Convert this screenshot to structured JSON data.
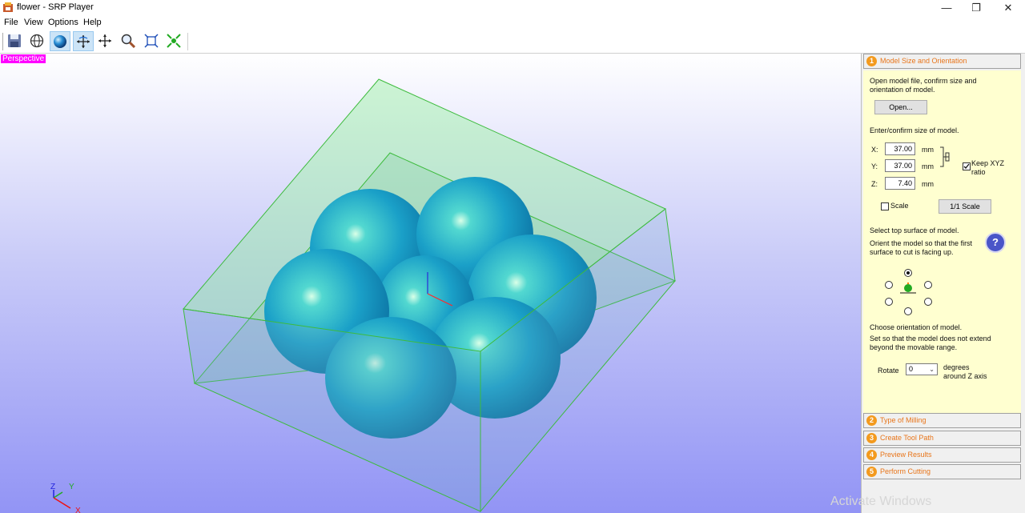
{
  "window": {
    "title": "flower - SRP Player",
    "minimize_label": "—",
    "maximize_label": "❐",
    "close_label": "✕"
  },
  "menu": {
    "items": [
      "File",
      "View",
      "Options",
      "Help"
    ]
  },
  "toolbar": {
    "buttons": [
      "save-icon",
      "globe-icon",
      "sphere-render-icon",
      "rotate-icon",
      "pan-icon",
      "zoom-icon",
      "fit-view-icon",
      "reset-view-icon"
    ],
    "active": [
      "sphere-render-icon",
      "rotate-icon"
    ]
  },
  "viewport": {
    "label": "Perspective",
    "axis_labels": {
      "z": "Z",
      "y": "Y",
      "x": "X"
    }
  },
  "panel": {
    "steps": [
      {
        "num": "1",
        "label": "Model Size and Orientation"
      },
      {
        "num": "2",
        "label": "Type of Milling"
      },
      {
        "num": "3",
        "label": "Create Tool Path"
      },
      {
        "num": "4",
        "label": "Preview Results"
      },
      {
        "num": "5",
        "label": "Perform Cutting"
      }
    ],
    "open_text": "Open model file, confirm size and orientation of model.",
    "open_button": "Open...",
    "size_text": "Enter/confirm size of model.",
    "x_label": "X:",
    "y_label": "Y:",
    "z_label": "Z:",
    "x_value": "37.00",
    "y_value": "37.00",
    "z_value": "7.40",
    "unit": "mm",
    "keep_ratio_label": "Keep XYZ ratio",
    "keep_ratio_checked": true,
    "scale_label": "Scale",
    "scale_checked": false,
    "scale_button": "1/1 Scale",
    "surface_title": "Select top surface of model.",
    "surface_text": "Orient the model so that the first surface to cut is facing up.",
    "help_label": "?",
    "orientation_title": "Choose orientation of model.",
    "orientation_text": "Set so that the model does not extend beyond the movable range.",
    "rotate_label": "Rotate",
    "rotate_value": "0",
    "rotate_unit": "degrees around Z axis"
  },
  "watermark": "Activate Windows",
  "colors": {
    "accent": "#e8751a",
    "panel_bg": "#ffffd0",
    "model": "#1aa0c8",
    "stock_edge": "#3dbb3d"
  }
}
